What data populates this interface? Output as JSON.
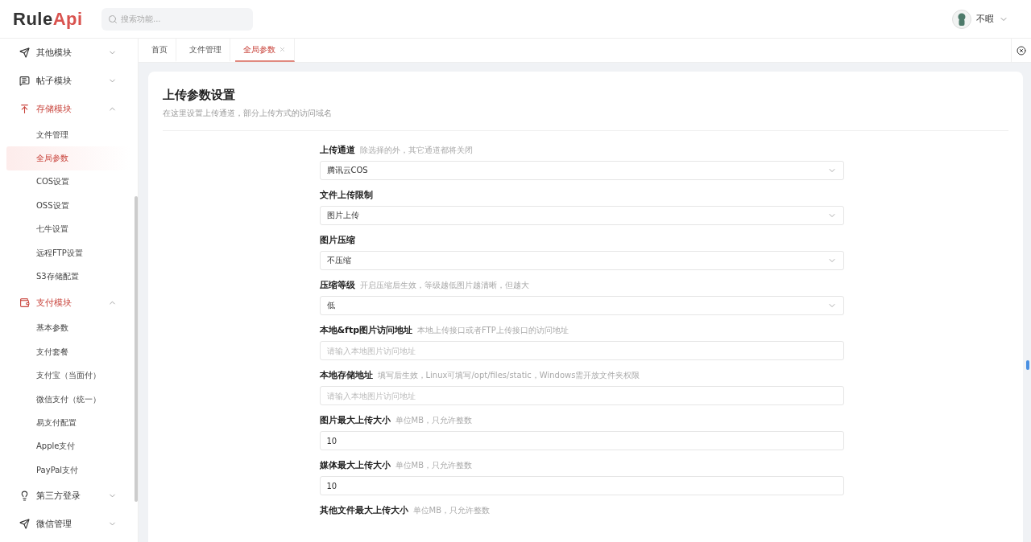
{
  "header": {
    "logo": {
      "part1": "Rule",
      "part2": "Api"
    },
    "search": {
      "placeholder": "搜索功能..."
    },
    "user": {
      "name": "不暇"
    }
  },
  "sidebar": {
    "items": [
      {
        "kind": "group",
        "label": "其他模块",
        "expanded": false
      },
      {
        "kind": "group",
        "label": "帖子模块",
        "expanded": false
      },
      {
        "kind": "group",
        "label": "存储模块",
        "expanded": true,
        "children": [
          {
            "label": "文件管理",
            "selected": false
          },
          {
            "label": "全局参数",
            "selected": true
          },
          {
            "label": "COS设置",
            "selected": false
          },
          {
            "label": "OSS设置",
            "selected": false
          },
          {
            "label": "七牛设置",
            "selected": false
          },
          {
            "label": "远程FTP设置",
            "selected": false
          },
          {
            "label": "S3存储配置",
            "selected": false
          }
        ]
      },
      {
        "kind": "group",
        "label": "支付模块",
        "expanded": true,
        "children": [
          {
            "label": "基本参数",
            "selected": false
          },
          {
            "label": "支付套餐",
            "selected": false
          },
          {
            "label": "支付宝（当面付）",
            "selected": false
          },
          {
            "label": "微信支付（统一）",
            "selected": false
          },
          {
            "label": "易支付配置",
            "selected": false
          },
          {
            "label": "Apple支付",
            "selected": false
          },
          {
            "label": "PayPal支付",
            "selected": false
          }
        ]
      },
      {
        "kind": "group",
        "label": "第三方登录",
        "expanded": false
      },
      {
        "kind": "group",
        "label": "微信管理",
        "expanded": false
      }
    ]
  },
  "tabs": [
    {
      "label": "首页",
      "selected": false,
      "closable": false
    },
    {
      "label": "文件管理",
      "selected": false,
      "closable": false
    },
    {
      "label": "全局参数",
      "selected": true,
      "closable": true
    }
  ],
  "page": {
    "title": "上传参数设置",
    "subtitle": "在这里设置上传通道，部分上传方式的访问域名",
    "fields": [
      {
        "kind": "select",
        "label": "上传通道",
        "hint": "除选择的外，其它通道都将关闭",
        "value": "腾讯云COS"
      },
      {
        "kind": "select",
        "label": "文件上传限制",
        "value": "图片上传"
      },
      {
        "kind": "select",
        "label": "图片压缩",
        "value": "不压缩"
      },
      {
        "kind": "select",
        "label": "压缩等级",
        "hint": "开启压缩后生效，等级越低图片越清晰，但越大",
        "value": "低"
      },
      {
        "kind": "input",
        "label": "本地&ftp图片访问地址",
        "hint": "本地上传接口或者FTP上传接口的访问地址",
        "placeholder": "请输入本地图片访问地址"
      },
      {
        "kind": "input",
        "label": "本地存储地址",
        "hint": "填写后生效，Linux可填写/opt/files/static，Windows需开放文件夹权限",
        "placeholder": "请输入本地图片访问地址"
      },
      {
        "kind": "input",
        "label": "图片最大上传大小",
        "hint": "单位MB，只允许整数",
        "value": "10"
      },
      {
        "kind": "input",
        "label": "媒体最大上传大小",
        "hint": "单位MB，只允许整数",
        "value": "10"
      },
      {
        "kind": "label",
        "label": "其他文件最大上传大小",
        "hint": "单位MB，只允许整数"
      }
    ]
  }
}
